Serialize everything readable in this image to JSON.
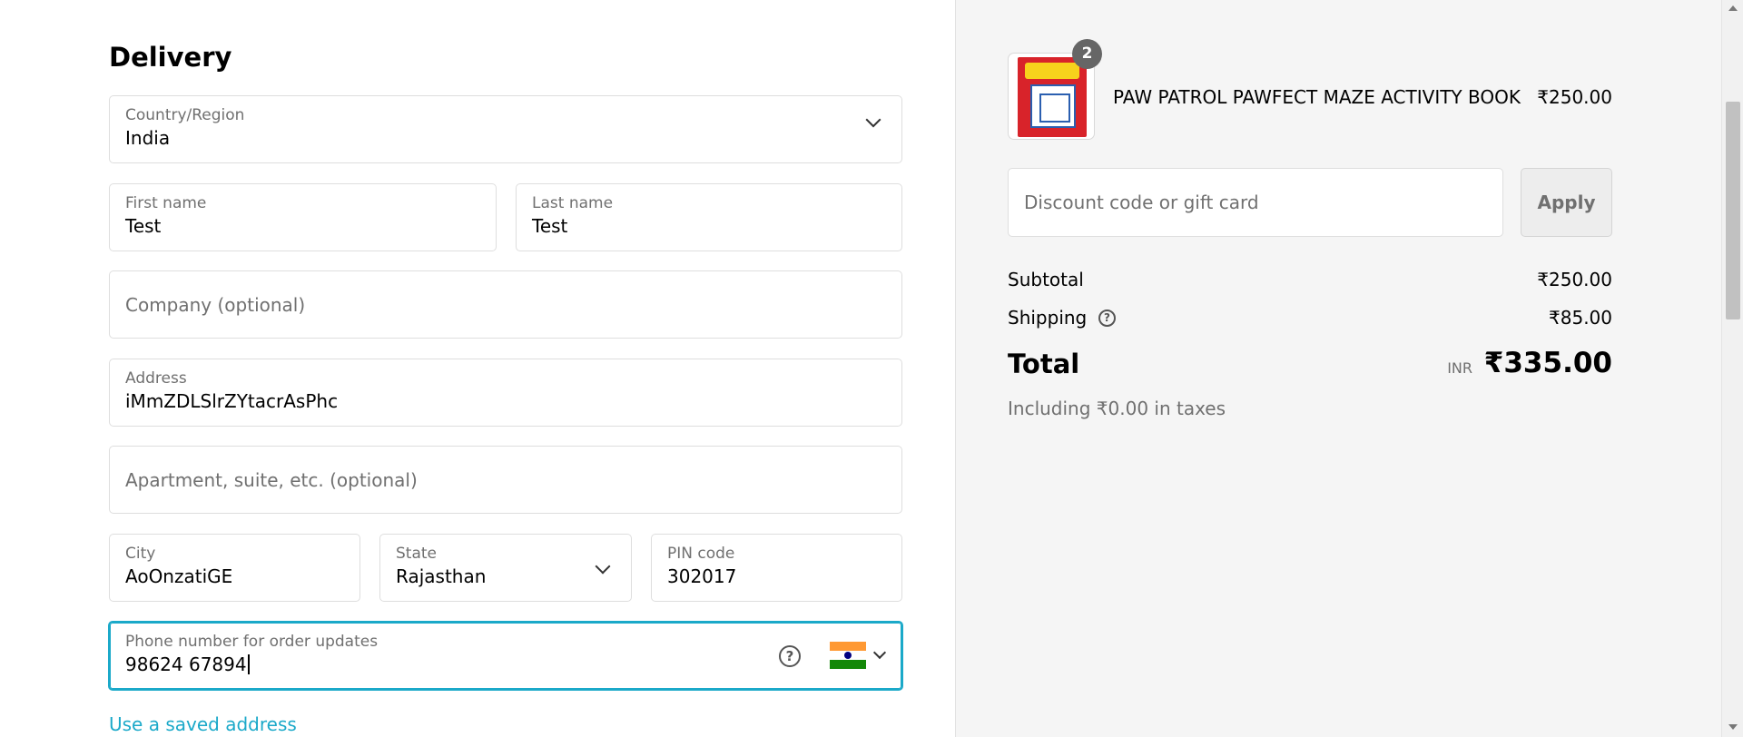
{
  "delivery": {
    "heading": "Delivery",
    "country": {
      "label": "Country/Region",
      "value": "India"
    },
    "first_name": {
      "label": "First name",
      "value": "Test"
    },
    "last_name": {
      "label": "Last name",
      "value": "Test"
    },
    "company": {
      "placeholder": "Company (optional)"
    },
    "address": {
      "label": "Address",
      "value": "iMmZDLSlrZYtacrAsPhc"
    },
    "apartment": {
      "placeholder": "Apartment, suite, etc. (optional)"
    },
    "city": {
      "label": "City",
      "value": "AoOnzatiGE"
    },
    "state": {
      "label": "State",
      "value": "Rajasthan"
    },
    "pin": {
      "label": "PIN code",
      "value": "302017"
    },
    "phone": {
      "label": "Phone number for order updates",
      "value": "98624 67894",
      "help_icon": "question-circle-icon",
      "flag_icon": "india-flag-icon"
    },
    "saved_address_link": "Use a saved address"
  },
  "summary": {
    "product": {
      "quantity": "2",
      "name": "PAW PATROL PAWFECT MAZE ACTIVITY BOOK",
      "price": "₹250.00"
    },
    "discount": {
      "placeholder": "Discount code or gift card",
      "apply_label": "Apply"
    },
    "subtotal_label": "Subtotal",
    "subtotal_value": "₹250.00",
    "shipping_label": "Shipping",
    "shipping_value": "₹85.00",
    "total_label": "Total",
    "currency": "INR",
    "total_value": "₹335.00",
    "taxes_note": "Including ₹0.00 in taxes"
  },
  "colors": {
    "accent": "#1ba9c9",
    "panel_bg": "#f5f5f5",
    "muted_text": "#707070"
  }
}
